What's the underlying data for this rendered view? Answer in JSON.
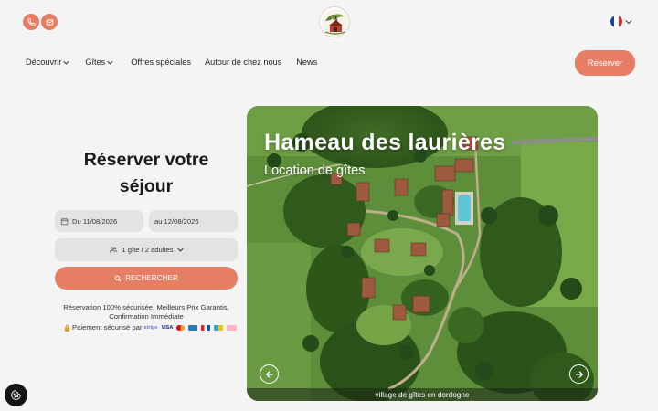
{
  "header": {
    "phone_icon": "phone-icon",
    "mail_icon": "mail-icon",
    "logo_icon": "hamlet-logo-icon",
    "language_icon": "french-flag-icon",
    "accent_color": "#e67d65"
  },
  "nav": {
    "items": [
      {
        "label": "Découvrir",
        "has_dropdown": true
      },
      {
        "label": "Gîtes",
        "has_dropdown": true
      },
      {
        "label": "Offres spéciales",
        "has_dropdown": false
      },
      {
        "label": "Autour de chez nous",
        "has_dropdown": false
      },
      {
        "label": "News",
        "has_dropdown": false
      }
    ],
    "book_label": "Réserver"
  },
  "booking": {
    "title_line1": "Réserver votre",
    "title_line2": "séjour",
    "date_from": "Du 11/08/2026",
    "date_to": "au 12/08/2026",
    "guests": "1 gîte / 2 adultes",
    "search_label": "RECHERCHER",
    "secure_line1": "Réservation 100% sécurisée, Meilleurs Prix Garantis,",
    "secure_line2": "Confirmation Immédiate",
    "payment_label": "Paiement sécurisé par",
    "payment_brand": "stripe",
    "payment_cards": [
      "VISA",
      "mastercard-icon",
      "amex-icon",
      "ancv-icon",
      "cheque-vacances-icon",
      "klarna-icon"
    ]
  },
  "hero": {
    "title": "Hameau des laurières",
    "subtitle": "Location de gîtes",
    "caption": "village de gîtes en dordogne",
    "prev_icon": "arrow-left-icon",
    "next_icon": "arrow-right-icon"
  },
  "cookie": {
    "icon": "cookie-icon"
  }
}
